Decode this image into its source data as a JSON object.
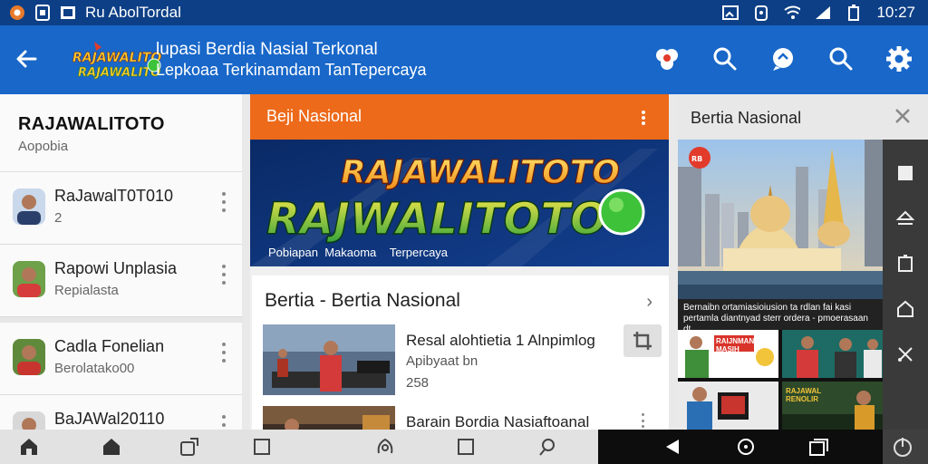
{
  "status_bar": {
    "app_label": "Ru AbolTordal",
    "time": "10:27"
  },
  "app_bar": {
    "title_line1": "lupasi Berdia Nasial Terkonal",
    "title_line2": "Lepkoaa Terkinamdam TanTepercaya",
    "logo_text_top": "RAJAWALITOTO",
    "logo_text_bottom": "RAJAWALITOTO"
  },
  "left_panel": {
    "title": "RAJAWALITOTO",
    "subtitle": "Aopobia",
    "contacts": [
      {
        "name": "RaJawalT0T010",
        "sub": "2"
      },
      {
        "name": "Rapowi Unplasia",
        "sub": "Repialasta"
      },
      {
        "name": "Cadla Fonelian",
        "sub": "Berolatako00"
      },
      {
        "name": "BaJAWal20110",
        "sub": ""
      }
    ]
  },
  "center_panel": {
    "header": "Beji Nasional",
    "banner": {
      "line1": "RAJAWALITOTO",
      "line2": "RAJWALITOTO",
      "caption_a": "Pobiapan",
      "caption_b": "Makaoma",
      "caption_c": "Terpercaya"
    },
    "section_title": "Bertia - Bertia Nasional",
    "news": [
      {
        "headline": "Resal alohtietia 1 Alnpimlog",
        "meta1": "Apibyaat bn",
        "meta2": "258"
      },
      {
        "headline": "Barain Bordia Nasiaftoanal",
        "meta1": "",
        "meta2": ""
      }
    ]
  },
  "right_panel": {
    "header": "Bertia Nasional",
    "strip_line1": "Bernaibn ortamiasioiusion ta rdlan fai kasi",
    "strip_line2": "pertamla diantnyad sterr ordera - pmoerasaan dt",
    "tiles": [
      {
        "label": "RAIJNMAN\nMASIH"
      },
      {
        "label": ""
      },
      {
        "label": ""
      },
      {
        "label": "RAJAWAL\nRENOLIR"
      }
    ]
  },
  "colors": {
    "status_bar": "#0d3f86",
    "app_bar": "#1867c9",
    "accent_orange": "#ed6a1a",
    "panel_bg": "#f4f4f4"
  },
  "icons": {
    "status": [
      "camera-icon",
      "sim-icon",
      "image-icon"
    ],
    "status_right": [
      "cast-icon",
      "alarm-icon",
      "wifi-icon",
      "signal-icon",
      "battery-icon"
    ],
    "app_actions": [
      "flower-icon",
      "search-icon",
      "chat-icon",
      "search-icon-2",
      "settings-icon"
    ],
    "bottom_nav": [
      "home-icon",
      "home-filled-icon",
      "share-icon",
      "square-icon",
      "location-icon",
      "square-icon-2",
      "search-icon",
      "back-triangle-icon",
      "home-circle-icon",
      "recents-icon",
      "power-icon"
    ]
  }
}
